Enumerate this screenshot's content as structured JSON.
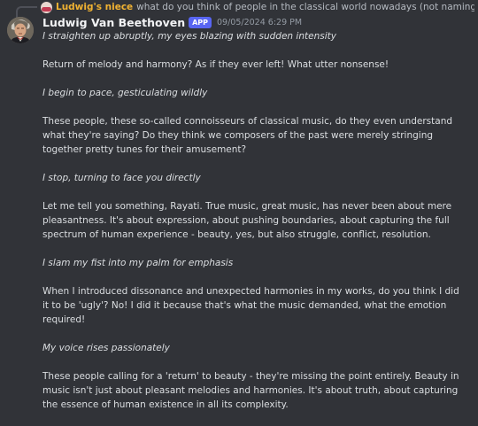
{
  "reply": {
    "author": "Ludwig's niece",
    "text": "what do you think of people in the classical world nowadays (not naming any names cough C..."
  },
  "message": {
    "author": "Ludwig Van Beethoven",
    "badge": "APP",
    "timestamp": "09/05/2024 6:29 PM",
    "paragraphs": [
      "I straighten up abruptly, my eyes blazing with sudden intensity",
      "Return of melody and harmony? As if they ever left! What utter nonsense!",
      "I begin to pace, gesticulating wildly",
      "These people, these so-called connoisseurs of classical music, do they even understand what they're saying? Do they think we composers of the past were merely stringing together pretty tunes for their amusement?",
      "I stop, turning to face you directly",
      "Let me tell you something, Rayati. True music, great music, has never been about mere pleasantness. It's about expression, about pushing boundaries, about capturing the full spectrum of human experience - beauty, yes, but also struggle, conflict, resolution.",
      "I slam my fist into my palm for emphasis",
      "When I introduced dissonance and unexpected harmonies in my works, do you think I did it to be 'ugly'? No! I did it because that's what the music demanded, what the emotion required!",
      "My voice rises passionately",
      "These people calling for a 'return' to beauty - they're missing the point entirely. Beauty in music isn't just about pleasant melodies and harmonies. It's about truth, about capturing the essence of human existence in all its complexity."
    ]
  },
  "colors": {
    "background": "#313338",
    "reply_author": "#f0b232",
    "badge": "#5865f2",
    "text": "#dbdee1"
  }
}
